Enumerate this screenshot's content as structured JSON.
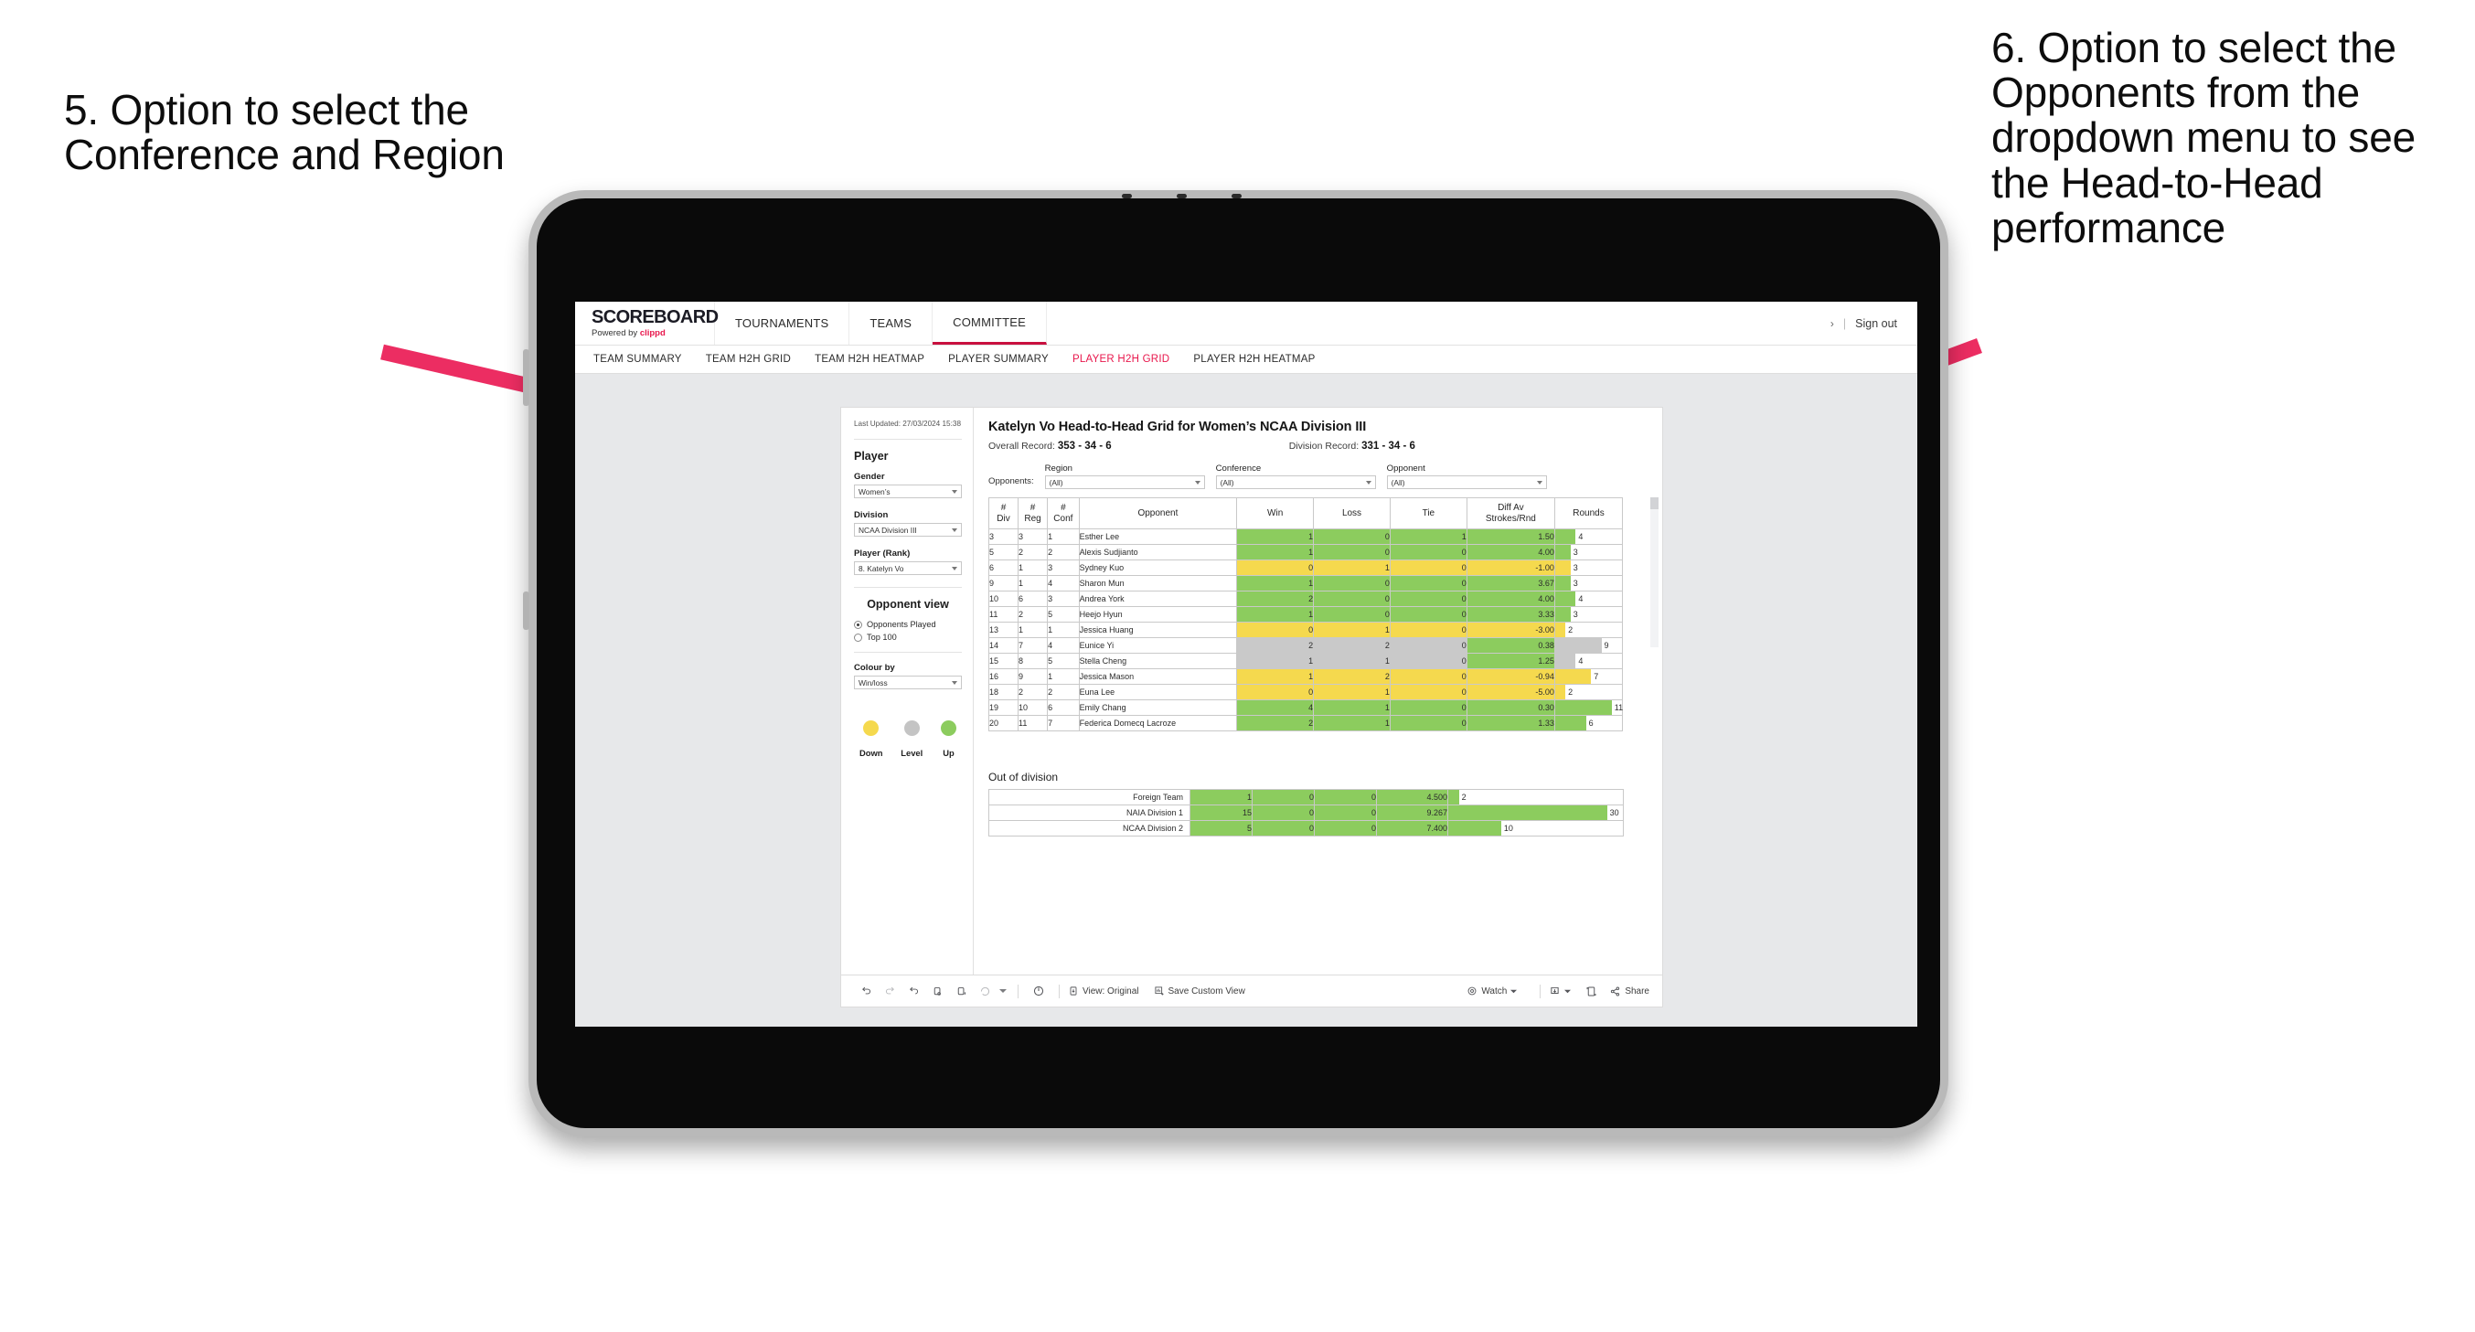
{
  "annotations": {
    "left": "5. Option to select the Conference and Region",
    "right": "6. Option to select the Opponents from the dropdown menu to see the Head-to-Head performance"
  },
  "app": {
    "brand": {
      "title": "SCOREBOARD",
      "powered_prefix": "Powered by ",
      "powered_brand": "clippd"
    },
    "nav_tabs": [
      {
        "label": "TOURNAMENTS",
        "active": false
      },
      {
        "label": "TEAMS",
        "active": false
      },
      {
        "label": "COMMITTEE",
        "active": true
      }
    ],
    "nav_right": {
      "chevron": "›",
      "separator": "|",
      "sign_out": "Sign out"
    },
    "sub_tabs": [
      {
        "label": "TEAM SUMMARY",
        "active": false
      },
      {
        "label": "TEAM H2H GRID",
        "active": false
      },
      {
        "label": "TEAM H2H HEATMAP",
        "active": false
      },
      {
        "label": "PLAYER SUMMARY",
        "active": false
      },
      {
        "label": "PLAYER H2H GRID",
        "active": true
      },
      {
        "label": "PLAYER H2H HEATMAP",
        "active": false
      }
    ]
  },
  "sidebar": {
    "last_updated": "Last Updated: 27/03/2024 15:38",
    "player_heading": "Player",
    "gender": {
      "label": "Gender",
      "value": "Women’s"
    },
    "division": {
      "label": "Division",
      "value": "NCAA Division III"
    },
    "player_rank": {
      "label": "Player (Rank)",
      "value": "8. Katelyn Vo"
    },
    "opponent_view": {
      "heading": "Opponent view",
      "options": [
        {
          "label": "Opponents Played",
          "selected": true
        },
        {
          "label": "Top 100",
          "selected": false
        }
      ]
    },
    "colour_by": {
      "label": "Colour by",
      "value": "Win/loss"
    },
    "legend": [
      {
        "label": "Down",
        "color": "#f5d94e"
      },
      {
        "label": "Level",
        "color": "#c4c4c4"
      },
      {
        "label": "Up",
        "color": "#8ccc5e"
      }
    ]
  },
  "main": {
    "title": "Katelyn Vo Head-to-Head Grid for Women’s NCAA Division III",
    "overall_record": {
      "label": "Overall Record: ",
      "value": "353 - 34 - 6"
    },
    "division_record": {
      "label": "Division Record: ",
      "value": "331 - 34 - 6"
    },
    "filters_label": "Opponents:",
    "filters": [
      {
        "label": "Region",
        "value": "(All)"
      },
      {
        "label": "Conference",
        "value": "(All)"
      },
      {
        "label": "Opponent",
        "value": "(All)"
      }
    ],
    "table": {
      "headers": [
        "# Div",
        "# Reg",
        "# Conf",
        "Opponent",
        "Win",
        "Loss",
        "Tie",
        "Diff Av Strokes/Rnd",
        "Rounds"
      ],
      "header_lines": [
        [
          "#",
          "Div"
        ],
        [
          "#",
          "Reg"
        ],
        [
          "#",
          "Conf"
        ],
        [
          "Opponent",
          ""
        ],
        [
          "Win",
          ""
        ],
        [
          "Loss",
          ""
        ],
        [
          "Tie",
          ""
        ],
        [
          "Diff Av",
          "Strokes/Rnd"
        ],
        [
          "Rounds",
          ""
        ]
      ],
      "rows": [
        {
          "div": "3",
          "reg": "3",
          "conf": "1",
          "opponent": "Esther Lee",
          "win": "1",
          "loss": "0",
          "tie": "1",
          "diff": "1.50",
          "rounds": "4",
          "color": "#8ccc5e"
        },
        {
          "div": "5",
          "reg": "2",
          "conf": "2",
          "opponent": "Alexis Sudjianto",
          "win": "1",
          "loss": "0",
          "tie": "0",
          "diff": "4.00",
          "rounds": "3",
          "color": "#8ccc5e"
        },
        {
          "div": "6",
          "reg": "1",
          "conf": "3",
          "opponent": "Sydney Kuo",
          "win": "0",
          "loss": "1",
          "tie": "0",
          "diff": "-1.00",
          "rounds": "3",
          "color": "#f5d94e"
        },
        {
          "div": "9",
          "reg": "1",
          "conf": "4",
          "opponent": "Sharon Mun",
          "win": "1",
          "loss": "0",
          "tie": "0",
          "diff": "3.67",
          "rounds": "3",
          "color": "#8ccc5e"
        },
        {
          "div": "10",
          "reg": "6",
          "conf": "3",
          "opponent": "Andrea York",
          "win": "2",
          "loss": "0",
          "tie": "0",
          "diff": "4.00",
          "rounds": "4",
          "color": "#8ccc5e"
        },
        {
          "div": "11",
          "reg": "2",
          "conf": "5",
          "opponent": "Heejo Hyun",
          "win": "1",
          "loss": "0",
          "tie": "0",
          "diff": "3.33",
          "rounds": "3",
          "color": "#8ccc5e"
        },
        {
          "div": "13",
          "reg": "1",
          "conf": "1",
          "opponent": "Jessica Huang",
          "win": "0",
          "loss": "1",
          "tie": "0",
          "diff": "-3.00",
          "rounds": "2",
          "color": "#f5d94e"
        },
        {
          "div": "14",
          "reg": "7",
          "conf": "4",
          "opponent": "Eunice Yi",
          "win": "2",
          "loss": "2",
          "tie": "0",
          "diff": "0.38",
          "rounds": "9",
          "color": "#c9c9c9",
          "diff_color": "#8ccc5e"
        },
        {
          "div": "15",
          "reg": "8",
          "conf": "5",
          "opponent": "Stella Cheng",
          "win": "1",
          "loss": "1",
          "tie": "0",
          "diff": "1.25",
          "rounds": "4",
          "color": "#c9c9c9",
          "diff_color": "#8ccc5e"
        },
        {
          "div": "16",
          "reg": "9",
          "conf": "1",
          "opponent": "Jessica Mason",
          "win": "1",
          "loss": "2",
          "tie": "0",
          "diff": "-0.94",
          "rounds": "7",
          "color": "#f5d94e"
        },
        {
          "div": "18",
          "reg": "2",
          "conf": "2",
          "opponent": "Euna Lee",
          "win": "0",
          "loss": "1",
          "tie": "0",
          "diff": "-5.00",
          "rounds": "2",
          "color": "#f5d94e"
        },
        {
          "div": "19",
          "reg": "10",
          "conf": "6",
          "opponent": "Emily Chang",
          "win": "4",
          "loss": "1",
          "tie": "0",
          "diff": "0.30",
          "rounds": "11",
          "color": "#8ccc5e"
        },
        {
          "div": "20",
          "reg": "11",
          "conf": "7",
          "opponent": "Federica Domecq Lacroze",
          "win": "2",
          "loss": "1",
          "tie": "0",
          "diff": "1.33",
          "rounds": "6",
          "color": "#8ccc5e"
        }
      ],
      "rounds_max": 13
    },
    "out_of_division": {
      "title": "Out of division",
      "rows": [
        {
          "name": "Foreign Team",
          "win": "1",
          "loss": "0",
          "tie": "0",
          "diff": "4.500",
          "rounds": "2",
          "color": "#8ccc5e"
        },
        {
          "name": "NAIA Division 1",
          "win": "15",
          "loss": "0",
          "tie": "0",
          "diff": "9.267",
          "rounds": "30",
          "color": "#8ccc5e"
        },
        {
          "name": "NCAA Division 2",
          "win": "5",
          "loss": "0",
          "tie": "0",
          "diff": "7.400",
          "rounds": "10",
          "color": "#8ccc5e"
        }
      ],
      "rounds_max": 33
    }
  },
  "toolbar": {
    "view_label": "View: Original",
    "save_label": "Save Custom View",
    "watch_label": "Watch",
    "share_label": "Share"
  },
  "colors": {
    "accent": "#e8174c",
    "arrow": "#ec2d62",
    "up": "#8ccc5e",
    "down": "#f5d94e",
    "level": "#c4c4c4"
  }
}
